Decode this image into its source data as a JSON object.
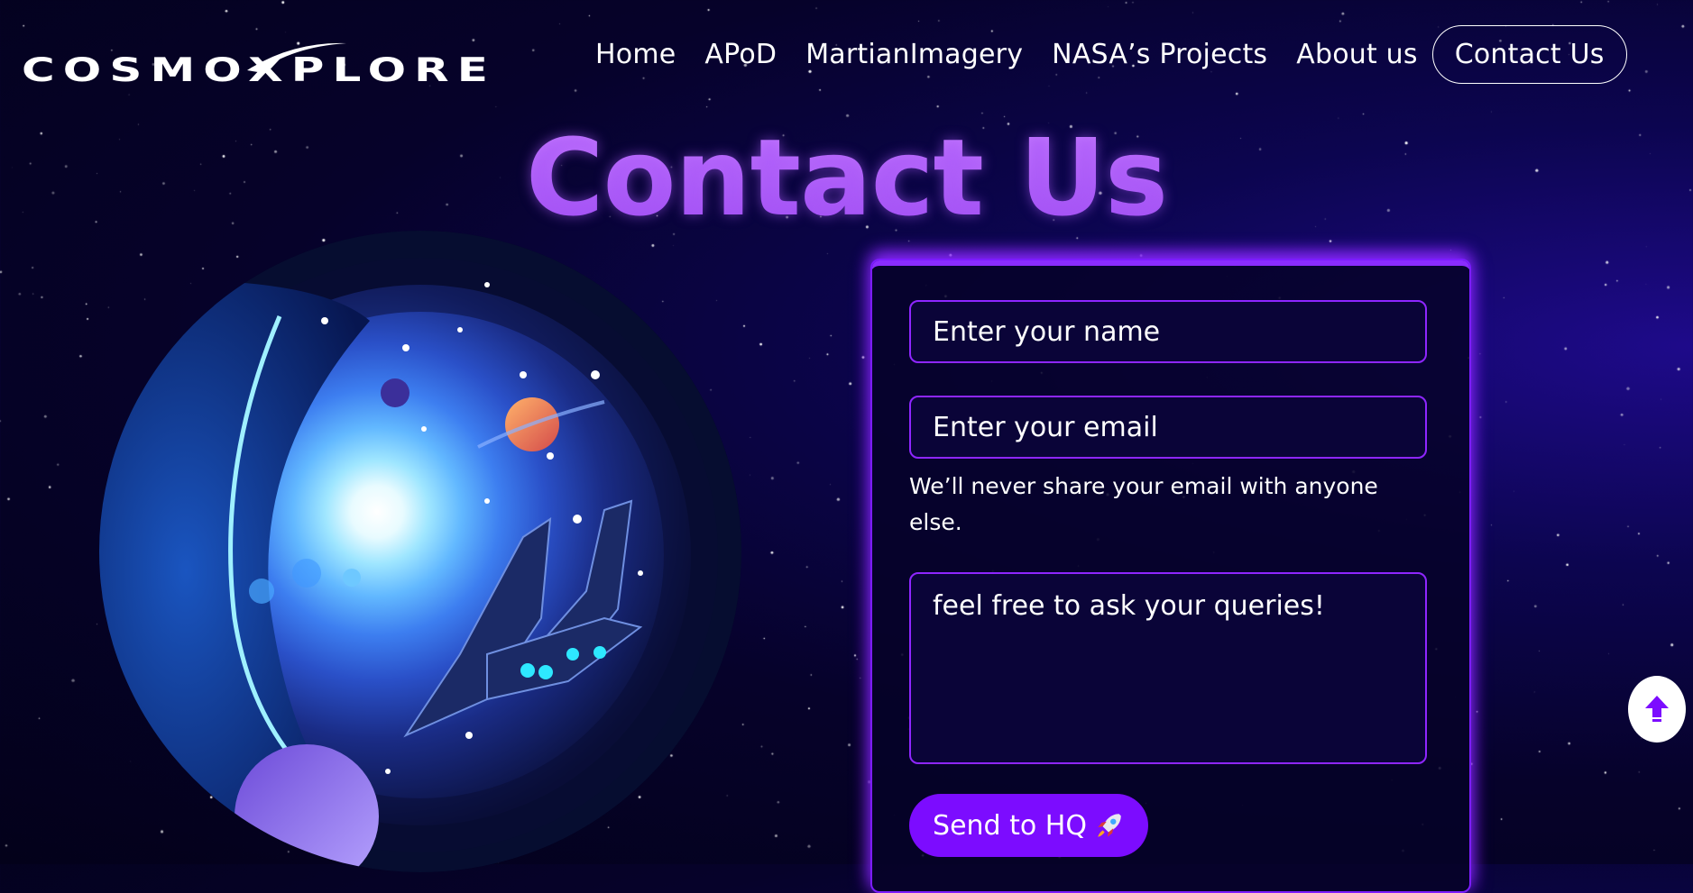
{
  "brand": {
    "logo_text": "COSMOXPLORE"
  },
  "nav": {
    "items": [
      "Home",
      "APoD",
      "MartianImagery",
      "NASA’s Projects",
      "About us"
    ],
    "contact_button": "Contact Us"
  },
  "page": {
    "title": "Contact Us"
  },
  "form": {
    "name_placeholder": "Enter your name",
    "email_placeholder": "Enter your email",
    "email_help": "We’ll never share your email with anyone else.",
    "message_placeholder": "feel free to ask your queries!",
    "submit_label": "Send to HQ"
  },
  "icons": {
    "rocket": "rocket-icon",
    "scroll_top": "arrow-up-icon"
  },
  "colors": {
    "accent": "#7c0cff",
    "title": "#b561ff",
    "background": "#06022a"
  }
}
